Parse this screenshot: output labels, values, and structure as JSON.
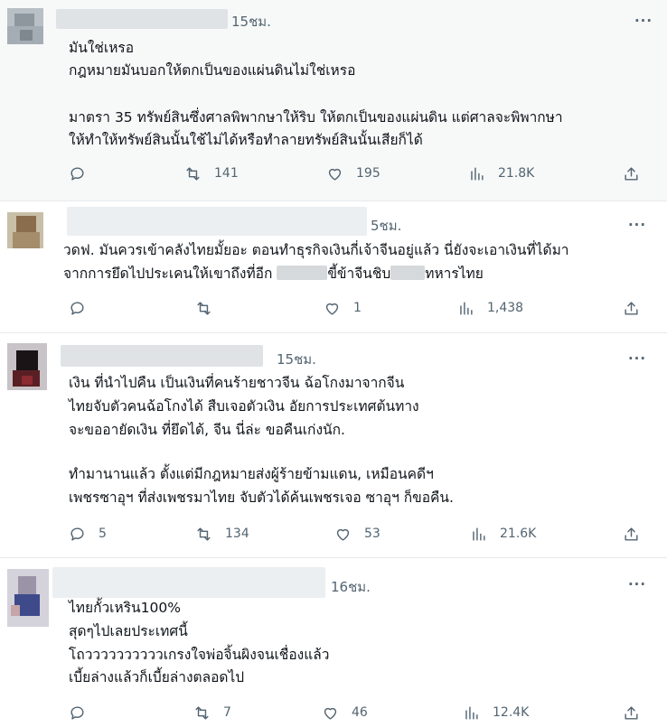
{
  "posts": [
    {
      "time": "15ชม.",
      "lines": [
        "มันใช่เหรอ",
        "กฎหมายมันบอกให้ตกเป็นของแผ่นดินไม่ใช่เหรอ",
        "มาตรา 35  ทรัพย์สินซึ่งศาลพิพากษาให้ริบ ให้ตกเป็นของแผ่นดิน แต่ศาลจะพิพากษา",
        "ให้ทำให้ทรัพย์สินนั้นใช้ไม่ได้หรือทำลายทรัพย์สินนั้นเสียก็ได้"
      ],
      "replies": "",
      "reposts": "141",
      "likes": "195",
      "views": "21.8K"
    },
    {
      "time": "5ชม.",
      "line1": "วดฟ. มันควรเข้าคลังไทยมั้ยอะ ตอนทำธุรกิจเงินกี่เจ้าจีนอยู่แล้ว นี่ยังจะเอาเงินที่ได้มา",
      "line2_a": "จากการยึดไปประเคนให้เขาถึงที่อีก",
      "line2_b": "ขี้ข้าจีนชิบ",
      "line2_c": "ทหารไทย",
      "replies": "",
      "reposts": "",
      "likes": "1",
      "views": "1,438"
    },
    {
      "time": "15ชม.",
      "lines": [
        "เงิน ที่นำไปคืน เป็นเงินที่คนร้ายชาวจีน ฉ้อโกงมาจากจีน",
        "ไทยจับตัวคนฉ้อโกงได้ สืบเจอตัวเงิน อัยการประเทศต้นทาง",
        "จะขออายัดเงิน ที่ยึดได้, จีน นี่ล่ะ ขอคืนเก่งนัก.",
        "ทำมานานแล้ว ตั้งแต่มีกฎหมายส่งผู้ร้ายข้ามแดน, เหมือนคดีฯ",
        "เพชรซาอุฯ ที่ส่งเพชรมาไทย จับตัวได้ค้นเพชรเจอ ซาอุฯ ก็ขอคืน."
      ],
      "replies": "5",
      "reposts": "134",
      "likes": "53",
      "views": "21.6K"
    },
    {
      "time": "16ชม.",
      "lines": [
        "ไทยกั้วเหริน100%",
        "สุดๆไปเลยประเทศนี้",
        "โถววววววววววเกรงใจพ่อจิ้นผิงจนเชื่องแล้ว",
        "เบี้ยล่างแล้วก็เบี้ยล่างตลอดไป"
      ],
      "replies": "",
      "reposts": "7",
      "likes": "46",
      "views": "12.4K"
    }
  ],
  "icons": {
    "reply": "reply-icon",
    "repost": "repost-icon",
    "like": "heart-icon",
    "views": "views-icon",
    "share": "share-icon",
    "more": "more-icon"
  },
  "colors": {
    "text": "#0f1419",
    "muted": "#536471",
    "divider": "#e6e9eb",
    "highlight_bg": "#f7f9f9"
  }
}
